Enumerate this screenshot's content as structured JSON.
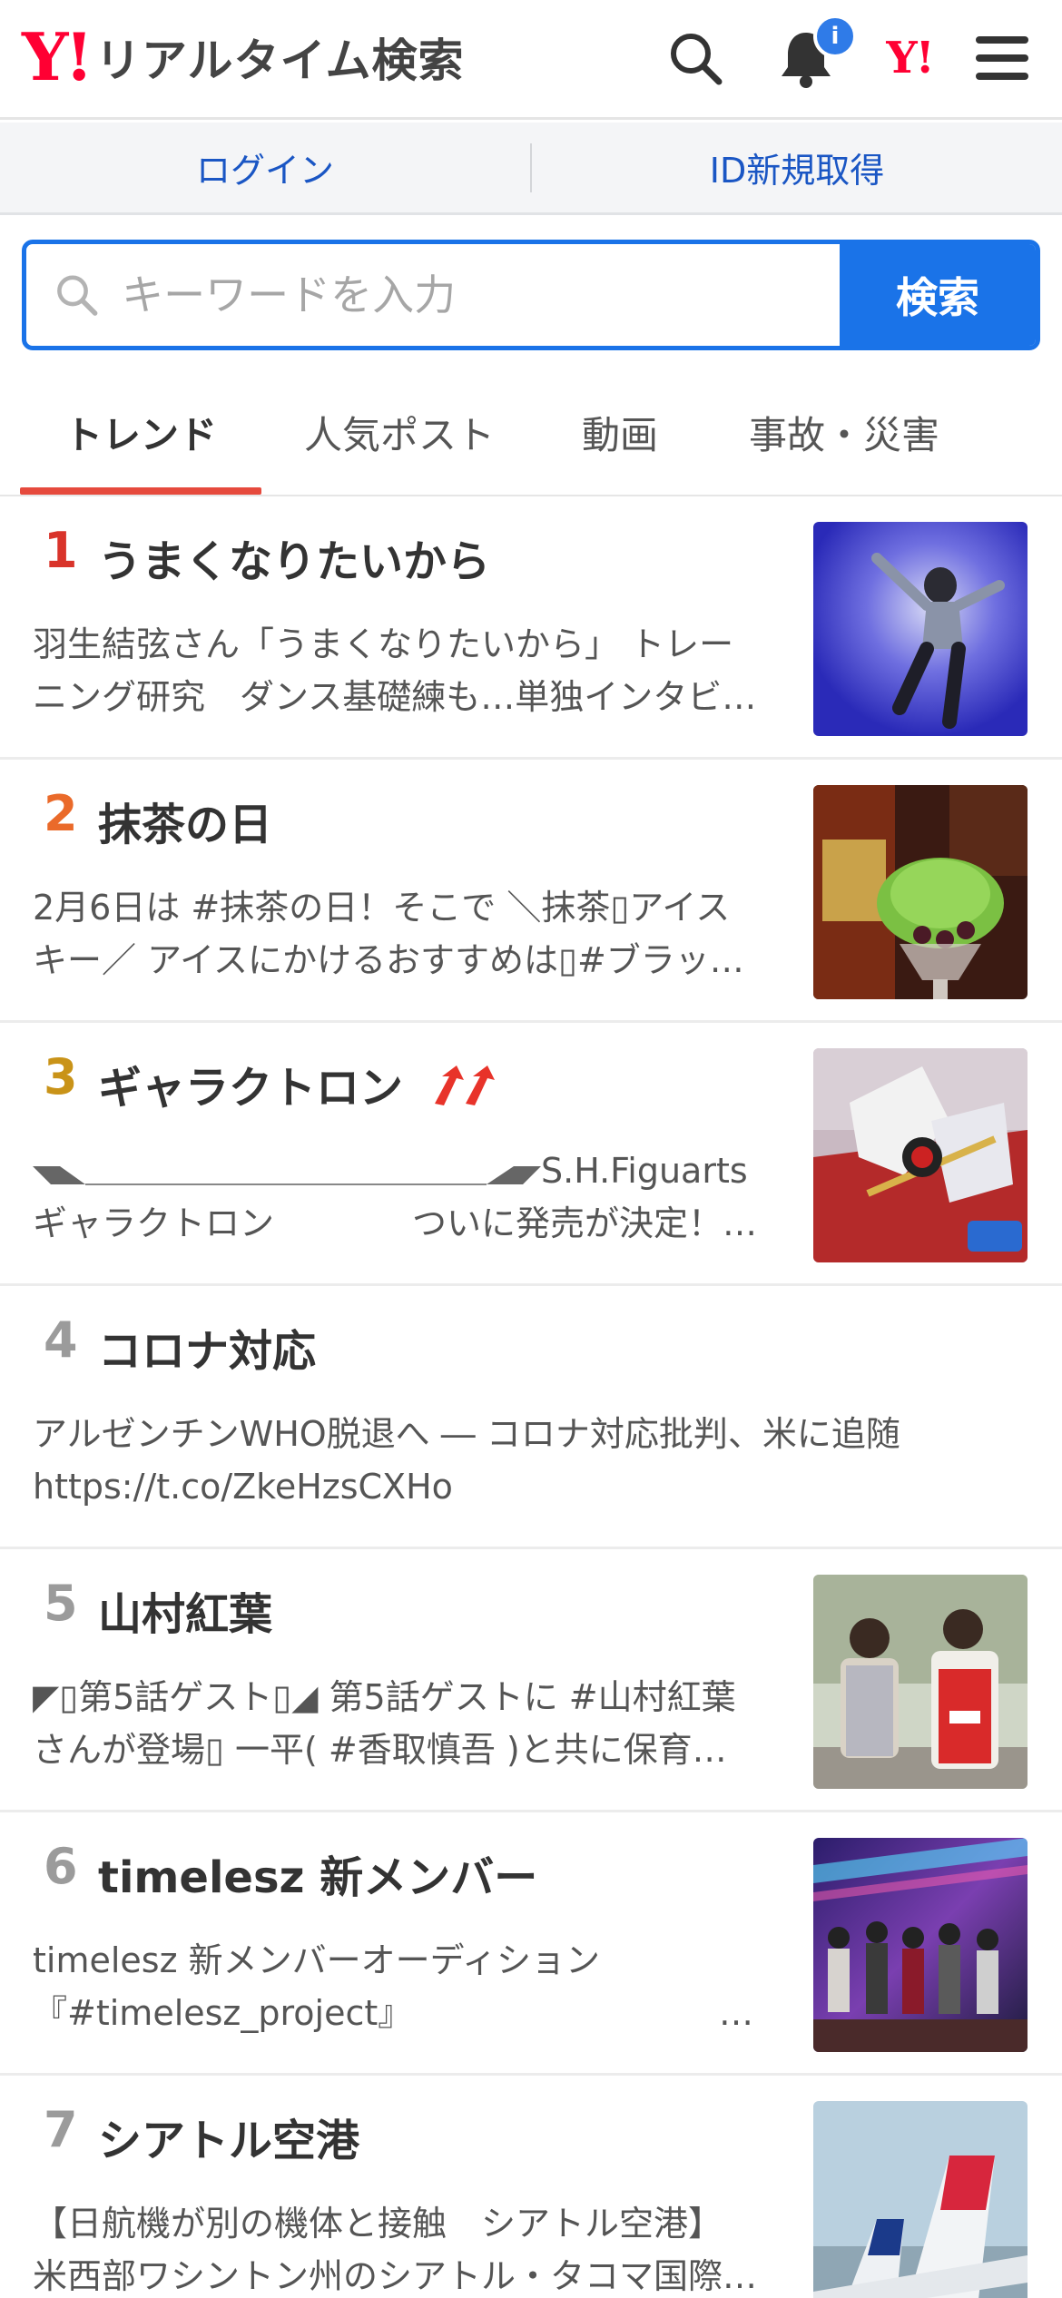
{
  "header": {
    "logo_mark": "Y!",
    "logo_text": "リアルタイム検索",
    "badge": "i",
    "yj_mark": "Y!"
  },
  "login_bar": {
    "login": "ログイン",
    "register": "ID新規取得"
  },
  "search": {
    "placeholder": "キーワードを入力",
    "button": "検索"
  },
  "tabs": [
    {
      "label": "トレンド",
      "active": true
    },
    {
      "label": "人気ポスト",
      "active": false
    },
    {
      "label": "動画",
      "active": false
    },
    {
      "label": "事故・災害",
      "active": false
    }
  ],
  "trends": [
    {
      "rank": "1",
      "title": "うまくなりたいから",
      "line1": "羽生結弦さん「うまくなりたいから」 トレー",
      "line2": "ニング研究　ダンス基礎練も…単独インタビ…",
      "thumb": "dancer on blue spotlight"
    },
    {
      "rank": "2",
      "title": "抹茶の日",
      "line1": "2月6日は #抹茶の日！そこで ＼抹茶▯アイス",
      "line2": "キー／ アイスにかけるおすすめは▯#ブラッ…",
      "thumb": "matcha ice cream"
    },
    {
      "rank": "3",
      "title": "ギャラクトロン",
      "line1": "S.H.Figuarts",
      "line2": "ギャラクトロン　　　　ついに発売が決定！…",
      "thumb": "galactron figure"
    },
    {
      "rank": "4",
      "title": "コロナ対応",
      "line1": "アルゼンチンWHO脱退へ ― コロナ対応批判、米に追随",
      "line2": "https://t.co/ZkeHzsCXHo",
      "thumb": ""
    },
    {
      "rank": "5",
      "title": "山村紅葉",
      "line1": "◤▯第5話ゲスト▯◢ 第5話ゲストに #山村紅葉",
      "line2": "さんが登場▯ 一平( #香取慎吾 )と共に保育…",
      "thumb": "two people outdoors"
    },
    {
      "rank": "6",
      "title": "timelesz 新メンバー",
      "line1": "timelesz 新メンバーオーディション",
      "line2": "『#timelesz_project』",
      "line2_end": "…",
      "thumb": "stage performance"
    },
    {
      "rank": "7",
      "title": "シアトル空港",
      "line1": "【日航機が別の機体と接触　シアトル空港】",
      "line2": "米西部ワシントン州のシアトル・タコマ国際…",
      "thumb": "airplane tails"
    }
  ],
  "colors": {
    "brand_red": "#ff0033",
    "link_blue": "#1a56c4",
    "search_blue": "#1a73e8",
    "tab_underline": "#e64a3d",
    "rank1": "#d9342b",
    "rank2": "#ea6a2a",
    "rank3": "#c99318",
    "rank_other": "#9b9b9b",
    "trend_up": "#e8332a"
  },
  "icons": [
    "search-icon",
    "bell-icon",
    "yahoo-japan-icon",
    "menu-icon",
    "trend-up-arrows-icon"
  ]
}
